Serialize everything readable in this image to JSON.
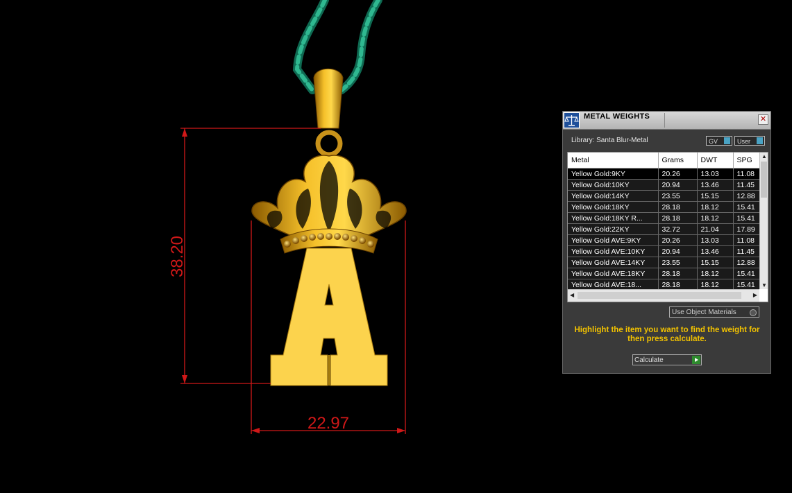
{
  "dimensions": {
    "height_label": "38.20",
    "width_label": "22.97",
    "color": "#d01818"
  },
  "panel": {
    "title": "METAL WEIGHTS",
    "close_label": "✕",
    "library_label": "Library: Santa Blur-Metal",
    "gv_label": "GV",
    "user_label": "User",
    "columns": [
      "Metal",
      "Grams",
      "DWT",
      "SPG"
    ],
    "rows": [
      {
        "metal": "Yellow Gold:9KY",
        "grams": "20.26",
        "dwt": "13.03",
        "spg": "11.08"
      },
      {
        "metal": "Yellow Gold:10KY",
        "grams": "20.94",
        "dwt": "13.46",
        "spg": "11.45"
      },
      {
        "metal": "Yellow Gold:14KY",
        "grams": "23.55",
        "dwt": "15.15",
        "spg": "12.88"
      },
      {
        "metal": "Yellow Gold:18KY",
        "grams": "28.18",
        "dwt": "18.12",
        "spg": "15.41"
      },
      {
        "metal": "Yellow Gold:18KY R...",
        "grams": "28.18",
        "dwt": "18.12",
        "spg": "15.41"
      },
      {
        "metal": "Yellow Gold:22KY",
        "grams": "32.72",
        "dwt": "21.04",
        "spg": "17.89"
      },
      {
        "metal": "Yellow Gold AVE:9KY",
        "grams": "20.26",
        "dwt": "13.03",
        "spg": "11.08"
      },
      {
        "metal": "Yellow Gold AVE:10KY",
        "grams": "20.94",
        "dwt": "13.46",
        "spg": "11.45"
      },
      {
        "metal": "Yellow Gold AVE:14KY",
        "grams": "23.55",
        "dwt": "15.15",
        "spg": "12.88"
      },
      {
        "metal": "Yellow Gold AVE:18KY",
        "grams": "28.18",
        "dwt": "18.12",
        "spg": "15.41"
      },
      {
        "metal": "Yellow Gold AVE:18...",
        "grams": "28.18",
        "dwt": "18.12",
        "spg": "15.41"
      }
    ],
    "use_object_label": "Use Object Materials",
    "instruction": "Highlight the item you want to find the weight for then press calculate.",
    "calculate_label": "Calculate",
    "accent_color": "#f2c200"
  }
}
